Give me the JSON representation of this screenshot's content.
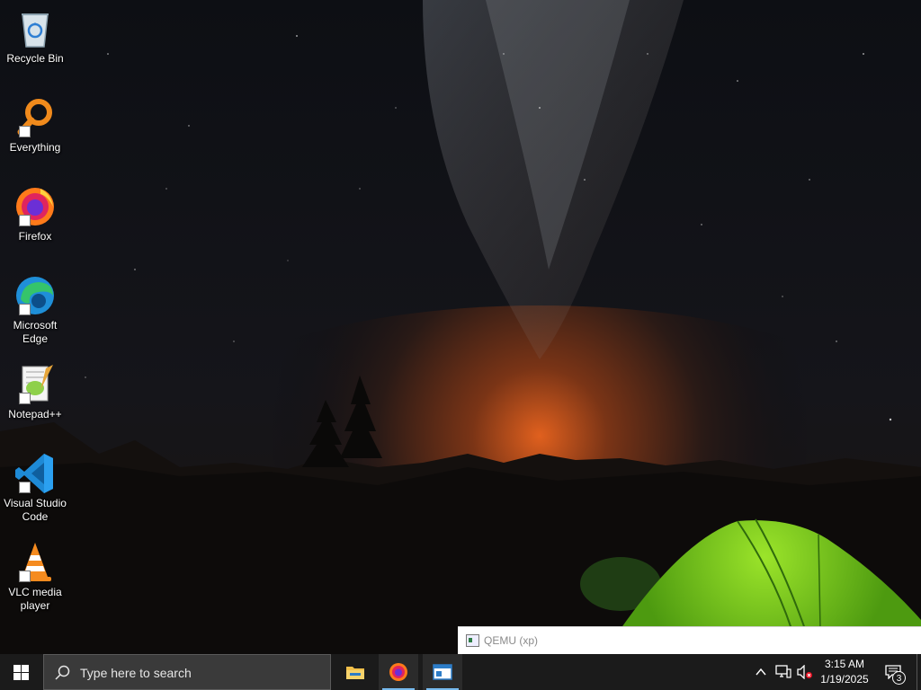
{
  "desktop": {
    "icons": [
      {
        "label": "Recycle Bin",
        "icon": "recycle-bin-icon"
      },
      {
        "label": "Everything",
        "icon": "everything-search-icon"
      },
      {
        "label": "Firefox",
        "icon": "firefox-icon"
      },
      {
        "label": "Microsoft Edge",
        "icon": "edge-icon"
      },
      {
        "label": "Notepad++",
        "icon": "notepadpp-icon"
      },
      {
        "label": "Visual Studio Code",
        "icon": "vscode-icon"
      },
      {
        "label": "VLC media player",
        "icon": "vlc-icon"
      }
    ]
  },
  "window": {
    "title": "QEMU (xp)"
  },
  "taskbar": {
    "search_placeholder": "Type here to search",
    "pinned": [
      {
        "name": "File Explorer",
        "icon": "folder-icon",
        "active": false
      },
      {
        "name": "Firefox",
        "icon": "firefox-icon",
        "active": true
      },
      {
        "name": "QEMU",
        "icon": "qemu-window-icon",
        "active": true
      }
    ],
    "clock": {
      "time": "3:15 AM",
      "date": "1/19/2025"
    },
    "notification_count": "3",
    "colors": {
      "taskbar_bg": "#1b1b1b",
      "search_bg": "#3a3a3a",
      "accent": "#76b9ed"
    }
  }
}
